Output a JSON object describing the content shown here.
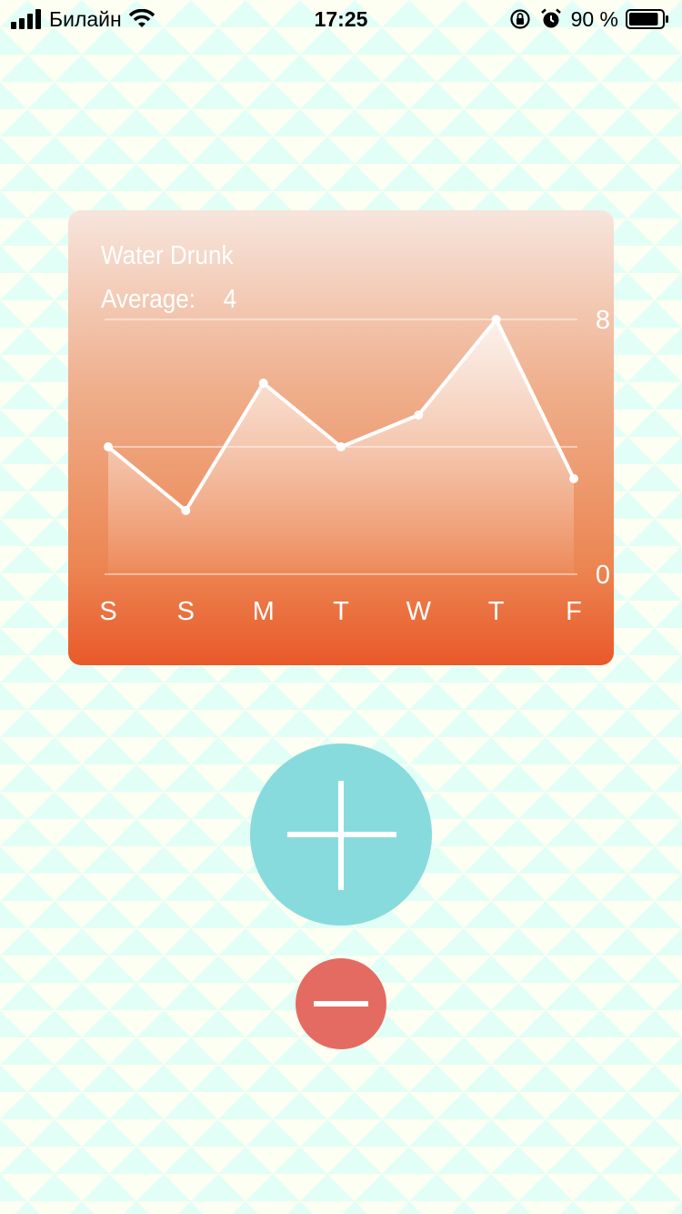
{
  "status_bar": {
    "carrier": "Билайн",
    "time": "17:25",
    "battery_percent": "90 %",
    "battery_level": 0.9
  },
  "chart": {
    "title": "Water Drunk",
    "average_label": "Average:",
    "average_value": "4"
  },
  "chart_data": {
    "type": "area",
    "title": "Water Drunk",
    "categories": [
      "S",
      "S",
      "M",
      "T",
      "W",
      "T",
      "F"
    ],
    "values": [
      4,
      2,
      6,
      4,
      5,
      8,
      3
    ],
    "ylim": [
      0,
      8
    ],
    "y_ticks": [
      "0",
      "8"
    ],
    "grid": true,
    "xlabel": "",
    "ylabel": ""
  },
  "colors": {
    "background": "#fdfff2",
    "pattern": "#e2fff7",
    "card_top": "#f7e5dd",
    "card_bottom": "#e9592a",
    "add_button": "#88dbdd",
    "remove_button": "#e46b61",
    "line": "#ffffff"
  },
  "icons": {
    "add": "plus-icon",
    "remove": "minus-icon"
  }
}
